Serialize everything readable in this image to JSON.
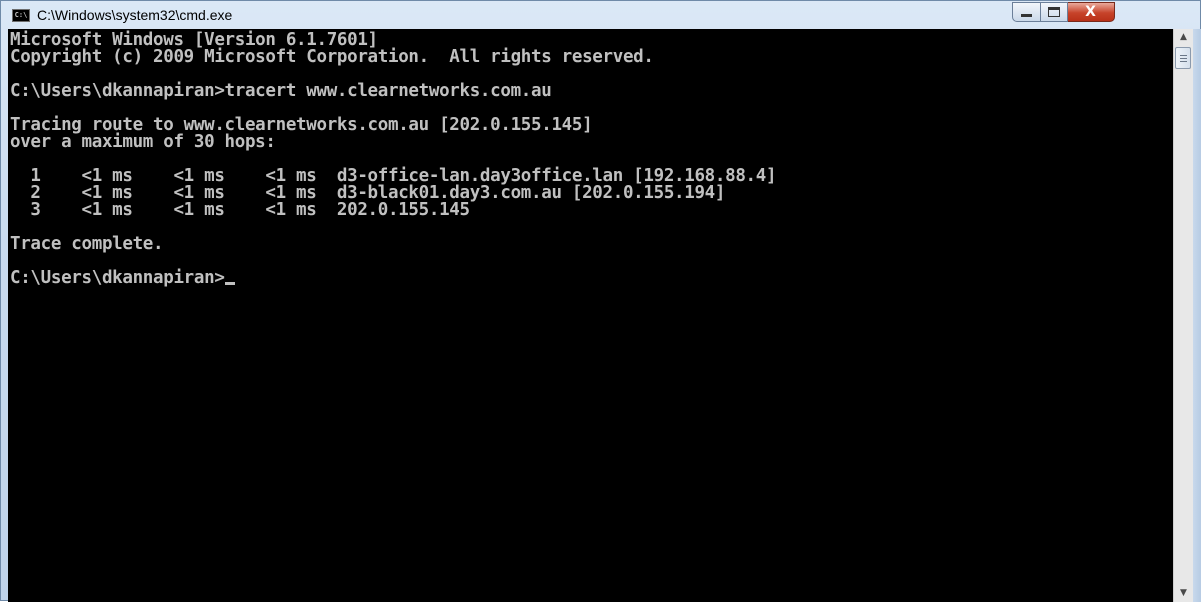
{
  "window": {
    "title": "C:\\Windows\\system32\\cmd.exe",
    "icon": "cmd-icon",
    "icon_text": "C:\\",
    "controls": {
      "minimize": "minimize-icon",
      "maximize": "maximize-icon",
      "close": "close-icon",
      "close_glyph": "X"
    }
  },
  "console": {
    "lines": [
      "Microsoft Windows [Version 6.1.7601]",
      "Copyright (c) 2009 Microsoft Corporation.  All rights reserved.",
      "",
      "C:\\Users\\dkannapiran>tracert www.clearnetworks.com.au",
      "",
      "Tracing route to www.clearnetworks.com.au [202.0.155.145]",
      "over a maximum of 30 hops:",
      "",
      "  1    <1 ms    <1 ms    <1 ms  d3-office-lan.day3office.lan [192.168.88.4]",
      "  2    <1 ms    <1 ms    <1 ms  d3-black01.day3.com.au [202.0.155.194]",
      "  3    <1 ms    <1 ms    <1 ms  202.0.155.145",
      "",
      "Trace complete.",
      ""
    ],
    "prompt": "C:\\Users\\dkannapiran>",
    "text_color": "#c0c0c0",
    "background_color": "#000000"
  },
  "scrollbar": {
    "up": "scroll-up-arrow-icon",
    "down": "scroll-down-arrow-icon"
  }
}
